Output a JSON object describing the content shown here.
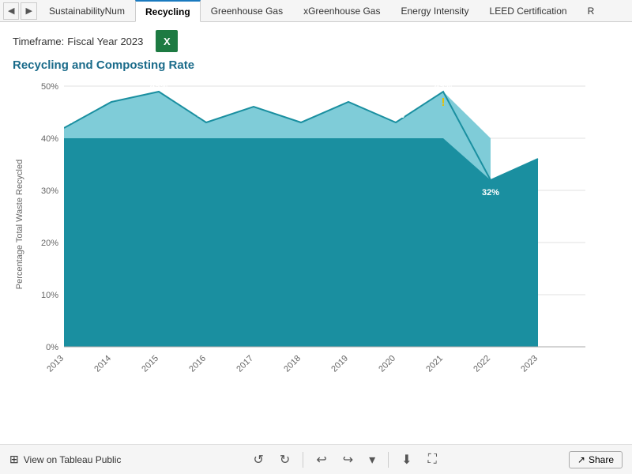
{
  "tabs": [
    {
      "label": "SustainabilityNum",
      "active": false
    },
    {
      "label": "Recycling",
      "active": true
    },
    {
      "label": "Greenhouse Gas",
      "active": false
    },
    {
      "label": "xGreenhouse Gas",
      "active": false
    },
    {
      "label": "Energy Intensity",
      "active": false
    },
    {
      "label": "LEED Certification",
      "active": false
    },
    {
      "label": "R",
      "active": false
    }
  ],
  "timeframe_label": "Timeframe:",
  "timeframe_value": "Fiscal Year 2023",
  "chart_title": "Recycling and Composting Rate",
  "y_axis_label": "Percentage Total Waste Recycled",
  "y_axis_ticks": [
    "50%",
    "40%",
    "30%",
    "20%",
    "10%",
    "0%"
  ],
  "x_axis_years": [
    "2013",
    "2014",
    "2015",
    "2016",
    "2017",
    "2018",
    "2019",
    "2020",
    "2021",
    "2022",
    "2023"
  ],
  "data_points": [
    {
      "year": "2013",
      "value": 42,
      "label": "42%"
    },
    {
      "year": "2014",
      "value": 47,
      "label": "47%"
    },
    {
      "year": "2015",
      "value": 49,
      "label": "49%"
    },
    {
      "year": "2016",
      "value": 43,
      "label": "43%"
    },
    {
      "year": "2017",
      "value": 46,
      "label": "46%"
    },
    {
      "year": "2018",
      "value": 43,
      "label": "43%"
    },
    {
      "year": "2019",
      "value": 47,
      "label": "47%"
    },
    {
      "year": "2020",
      "value": 43,
      "label": "43%"
    },
    {
      "year": "2021",
      "value": 49,
      "label": "49%"
    },
    {
      "year": "2022",
      "value": 32,
      "label": "32%"
    },
    {
      "year": "2023",
      "value": 36,
      "label": "36%"
    }
  ],
  "warning_year": "2021",
  "warning_symbol": "!",
  "excel_label": "X",
  "bottom": {
    "view_label": "View on Tableau Public",
    "share_label": "Share"
  }
}
